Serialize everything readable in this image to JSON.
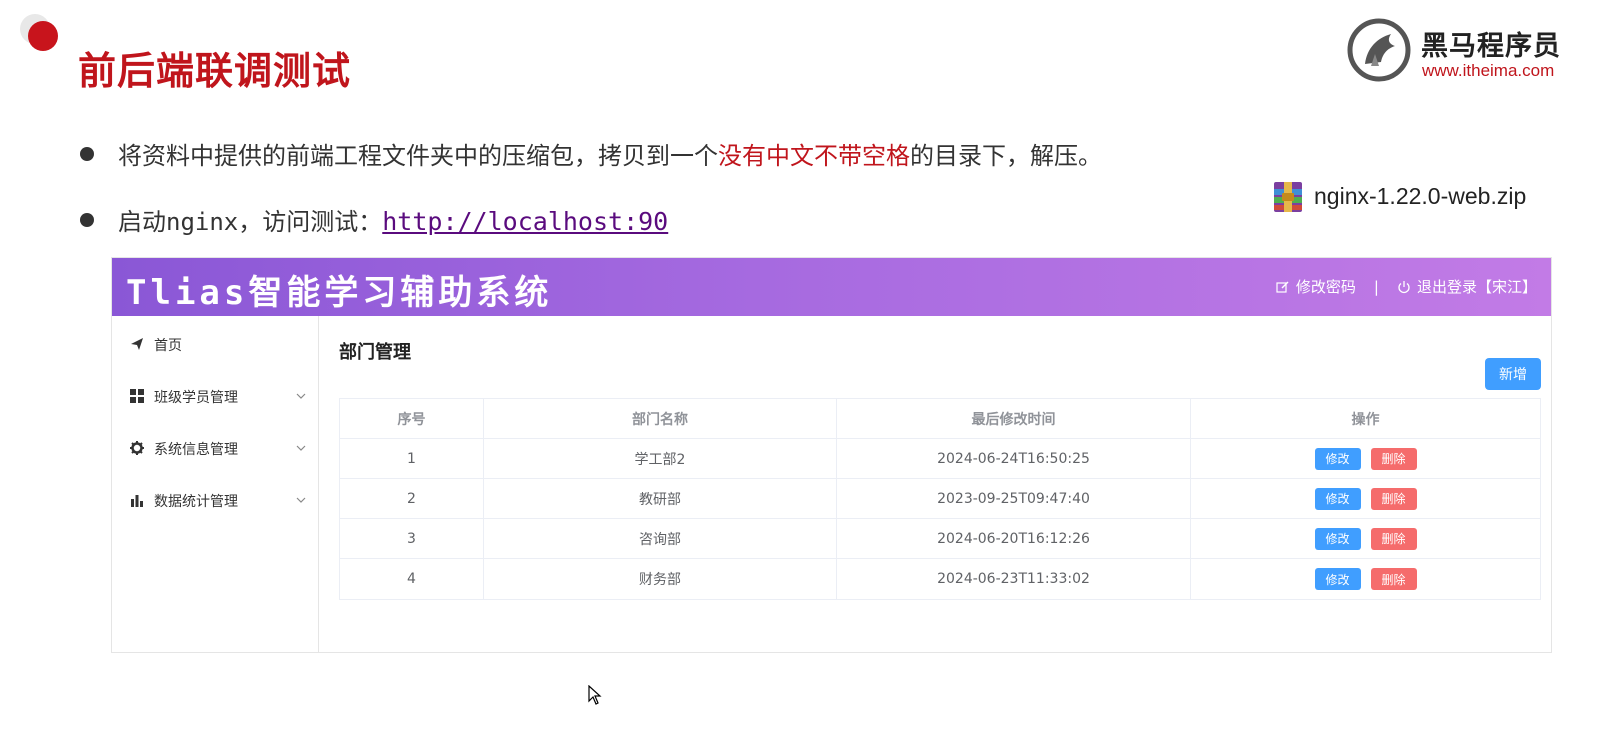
{
  "slide": {
    "title": "前后端联调测试",
    "logo": {
      "name": "黑马程序员",
      "url": "www.itheima.com"
    },
    "bullets": [
      {
        "pre": "将资料中提供的前端工程文件夹中的压缩包，拷贝到一个",
        "highlight": "没有中文不带空格",
        "post": "的目录下，解压。"
      },
      {
        "pre": "启动",
        "mono": "nginx",
        "mid": "，访问测试：",
        "link": "http://localhost:90"
      }
    ],
    "zip_file": "nginx-1.22.0-web.zip"
  },
  "app": {
    "title": "Tlias智能学习辅助系统",
    "header_actions": {
      "change_password": "修改密码",
      "separator": "|",
      "logout": "退出登录【宋江】"
    },
    "sidebar": [
      {
        "label": "首页",
        "icon": "paper-plane-icon",
        "expandable": false
      },
      {
        "label": "班级学员管理",
        "icon": "grid-icon",
        "expandable": true
      },
      {
        "label": "系统信息管理",
        "icon": "gear-icon",
        "expandable": true
      },
      {
        "label": "数据统计管理",
        "icon": "bar-chart-icon",
        "expandable": true
      }
    ],
    "page_title": "部门管理",
    "add_button": "新增",
    "table": {
      "headers": [
        "序号",
        "部门名称",
        "最后修改时间",
        "操作"
      ],
      "rows": [
        {
          "index": "1",
          "name": "学工部2",
          "updated": "2024-06-24T16:50:25"
        },
        {
          "index": "2",
          "name": "教研部",
          "updated": "2023-09-25T09:47:40"
        },
        {
          "index": "3",
          "name": "咨询部",
          "updated": "2024-06-20T16:12:26"
        },
        {
          "index": "4",
          "name": "财务部",
          "updated": "2024-06-23T11:33:02"
        }
      ],
      "edit_label": "修改",
      "delete_label": "删除"
    }
  },
  "colors": {
    "brand_red": "#c0151c",
    "primary": "#409eff",
    "danger": "#f56c6c",
    "header_gradient_start": "#8a57d6",
    "header_gradient_end": "#c27be6"
  }
}
